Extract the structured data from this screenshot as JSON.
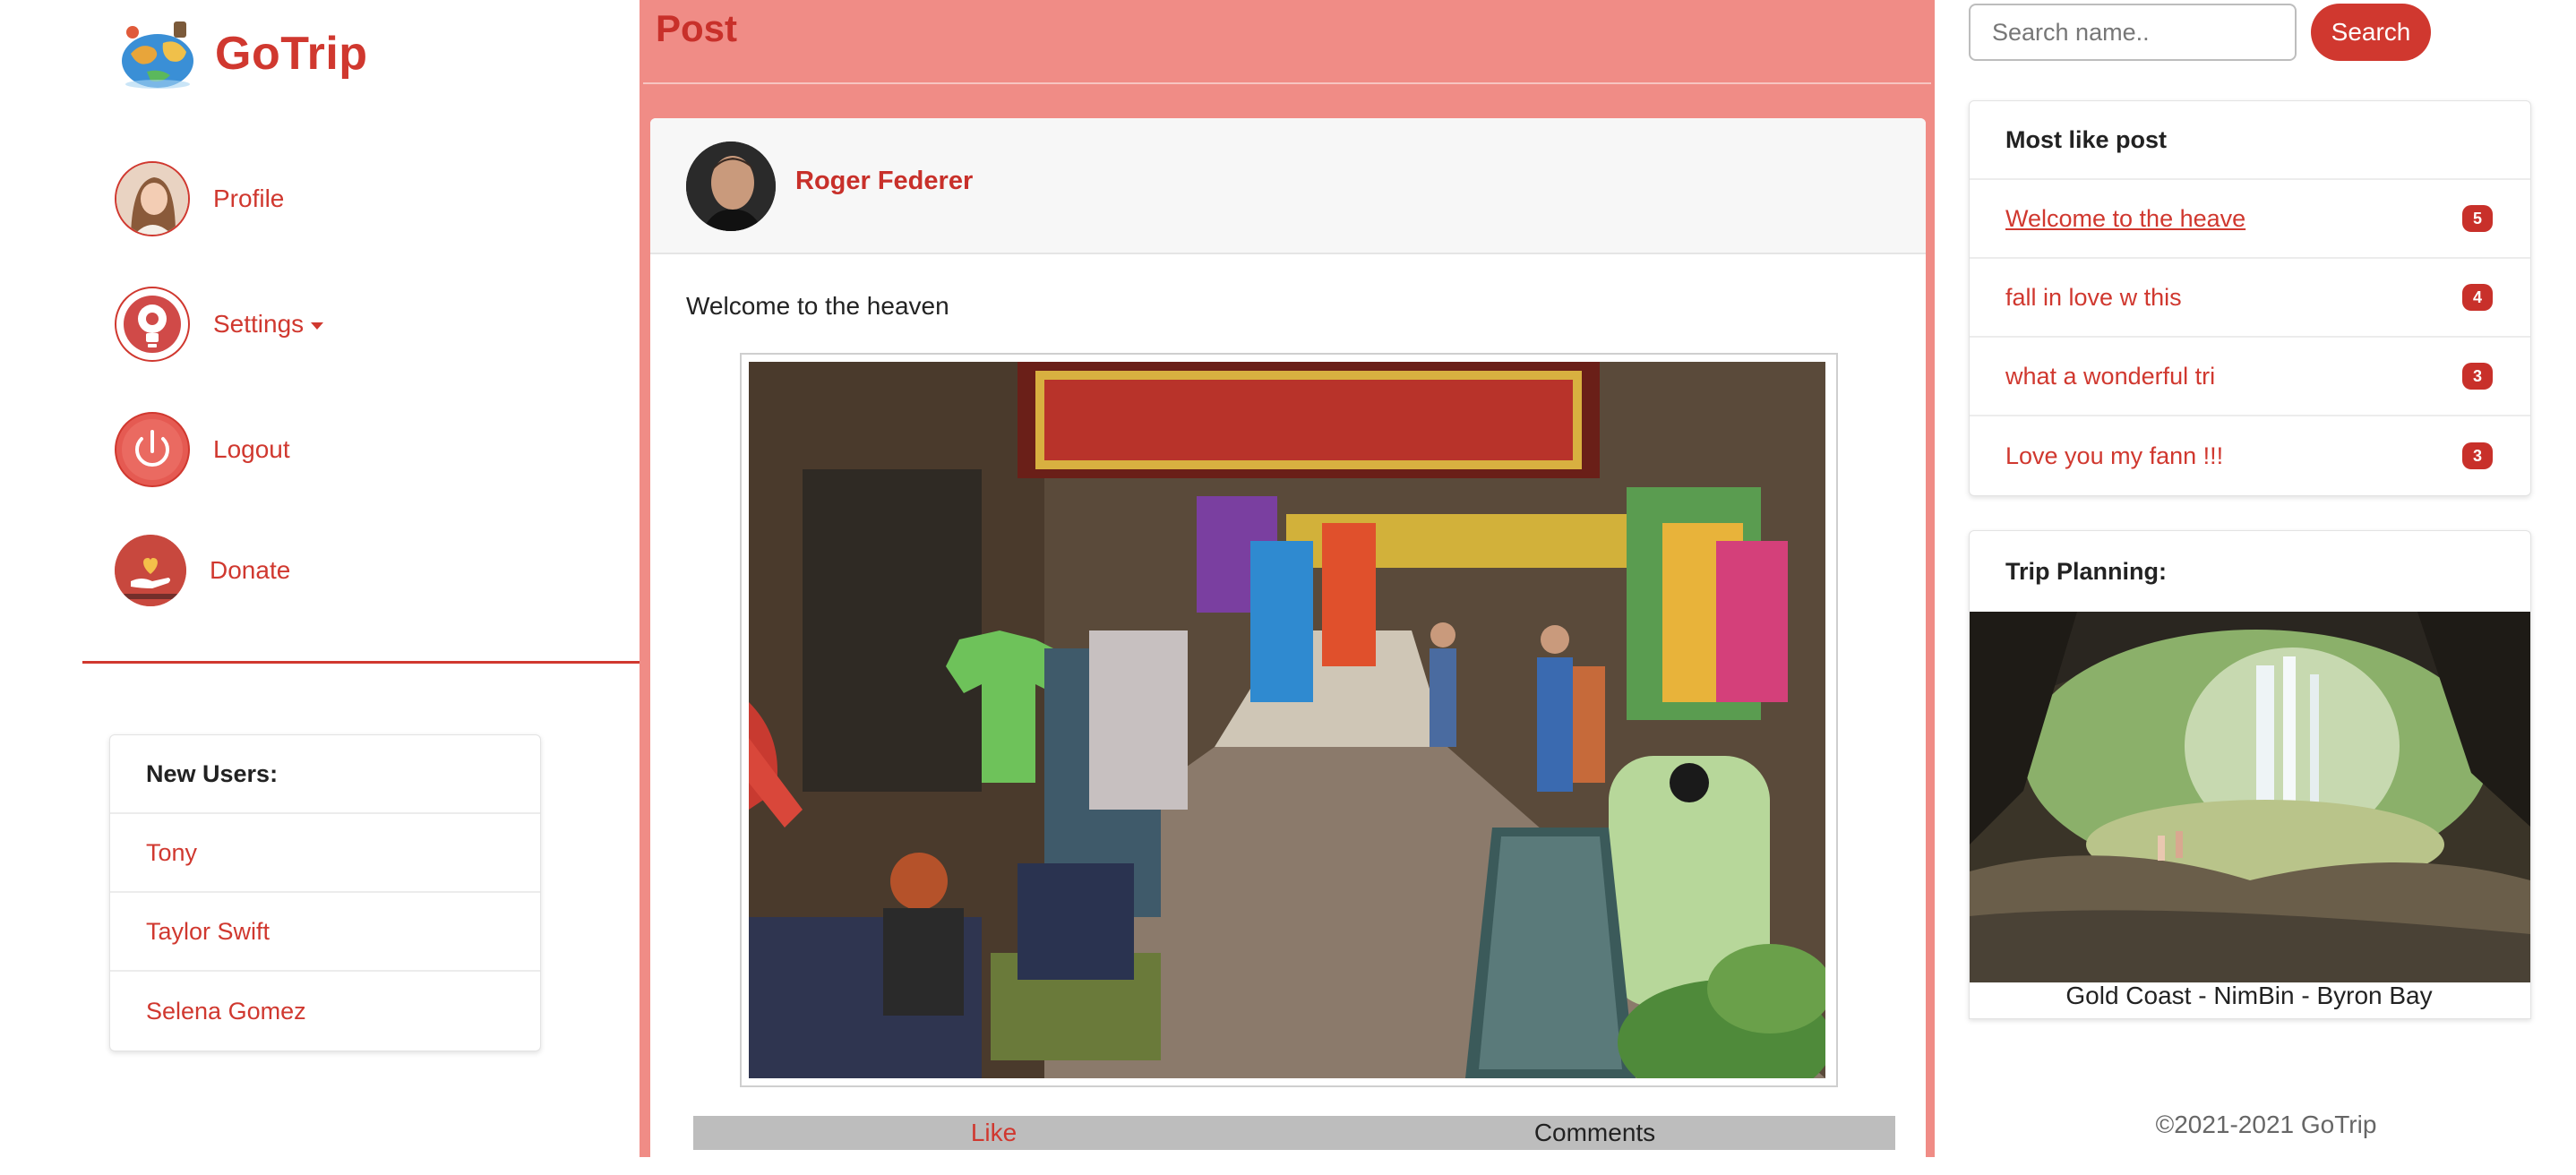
{
  "brand": {
    "name": "GoTrip",
    "accent": "#d0382f"
  },
  "nav": [
    {
      "label": "Profile",
      "icon": "profile-photo"
    },
    {
      "label": "Settings",
      "icon": "lightbulb-gear-icon"
    },
    {
      "label": "Logout",
      "icon": "power-icon"
    },
    {
      "label": "Donate",
      "icon": "hand-heart-icon"
    }
  ],
  "new_users": {
    "title": "New Users:",
    "items": [
      "Tony",
      "Taylor Swift",
      "Selena Gomez"
    ]
  },
  "post": {
    "section_title": "Post",
    "author": "Roger Federer",
    "text": "Welcome to the heaven",
    "like_label": "Like",
    "comments_label": "Comments"
  },
  "search": {
    "placeholder": "Search name..",
    "button_label": "Search"
  },
  "most_liked": {
    "title": "Most like post",
    "items": [
      {
        "title": "Welcome to the heave",
        "count": "5"
      },
      {
        "title": "fall in love w this",
        "count": "4"
      },
      {
        "title": "what a wonderful tri",
        "count": "3"
      },
      {
        "title": "Love you my fann !!!",
        "count": "3"
      }
    ]
  },
  "trip": {
    "title": "Trip Planning:",
    "caption": "Gold Coast - NimBin - Byron Bay"
  },
  "footer": {
    "text": "©2021-2021 GoTrip"
  }
}
